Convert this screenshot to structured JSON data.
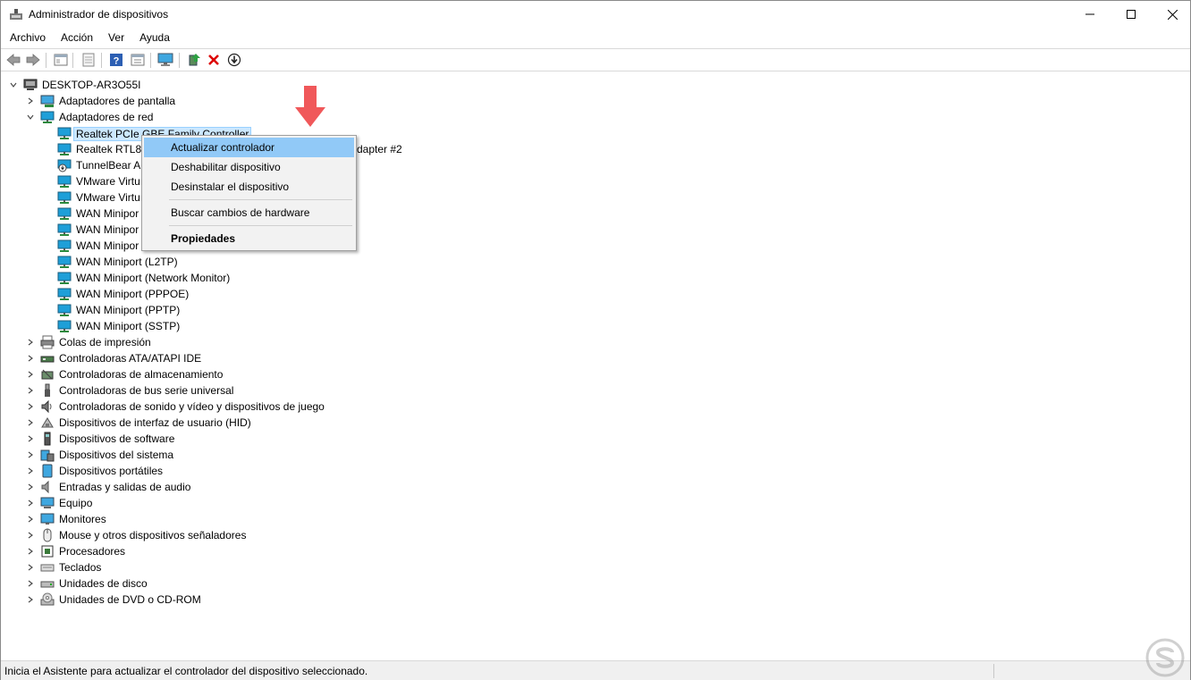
{
  "window": {
    "title": "Administrador de dispositivos",
    "controls": {
      "minimize": "—",
      "maximize": "☐",
      "close": "✕"
    }
  },
  "menu": [
    "Archivo",
    "Acción",
    "Ver",
    "Ayuda"
  ],
  "toolbar": {
    "icons": [
      "back-icon",
      "forward-icon",
      "properties-view-icon",
      "properties-icon",
      "help-icon",
      "resources-icon",
      "monitor-icon",
      "update-driver-icon",
      "uninstall-icon",
      "scan-hardware-icon"
    ]
  },
  "tree": {
    "root": "DESKTOP-AR3O55I",
    "items": [
      {
        "label": "Adaptadores de pantalla",
        "icon": "display-adapter-icon",
        "level": 1,
        "expander": "collapsed"
      },
      {
        "label": "Adaptadores de red",
        "icon": "network-icon",
        "level": 1,
        "expander": "expanded"
      },
      {
        "label": "Realtek PCIe GBE Family Controller",
        "icon": "network-icon",
        "level": 2,
        "selected": true
      },
      {
        "label": "Realtek RTL81",
        "suffix": "dapter #2",
        "icon": "network-icon",
        "level": 2
      },
      {
        "label": "TunnelBear A",
        "icon": "network-warning-icon",
        "level": 2
      },
      {
        "label": "VMware Virtu",
        "icon": "network-icon",
        "level": 2
      },
      {
        "label": "VMware Virtu",
        "icon": "network-icon",
        "level": 2
      },
      {
        "label": "WAN Minipor",
        "icon": "network-icon",
        "level": 2
      },
      {
        "label": "WAN Minipor",
        "icon": "network-icon",
        "level": 2
      },
      {
        "label": "WAN Minipor",
        "icon": "network-icon",
        "level": 2
      },
      {
        "label": "WAN Miniport (L2TP)",
        "icon": "network-icon",
        "level": 2
      },
      {
        "label": "WAN Miniport (Network Monitor)",
        "icon": "network-icon",
        "level": 2
      },
      {
        "label": "WAN Miniport (PPPOE)",
        "icon": "network-icon",
        "level": 2
      },
      {
        "label": "WAN Miniport (PPTP)",
        "icon": "network-icon",
        "level": 2
      },
      {
        "label": "WAN Miniport (SSTP)",
        "icon": "network-icon",
        "level": 2
      },
      {
        "label": "Colas de impresión",
        "icon": "printer-icon",
        "level": 1,
        "expander": "collapsed"
      },
      {
        "label": "Controladoras ATA/ATAPI IDE",
        "icon": "ide-controller-icon",
        "level": 1,
        "expander": "collapsed"
      },
      {
        "label": "Controladoras de almacenamiento",
        "icon": "storage-controller-icon",
        "level": 1,
        "expander": "collapsed"
      },
      {
        "label": "Controladoras de bus serie universal",
        "icon": "usb-icon",
        "level": 1,
        "expander": "collapsed"
      },
      {
        "label": "Controladoras de sonido y vídeo y dispositivos de juego",
        "icon": "sound-icon",
        "level": 1,
        "expander": "collapsed"
      },
      {
        "label": "Dispositivos de interfaz de usuario (HID)",
        "icon": "hid-icon",
        "level": 1,
        "expander": "collapsed"
      },
      {
        "label": "Dispositivos de software",
        "icon": "software-device-icon",
        "level": 1,
        "expander": "collapsed"
      },
      {
        "label": "Dispositivos del sistema",
        "icon": "system-device-icon",
        "level": 1,
        "expander": "collapsed"
      },
      {
        "label": "Dispositivos portátiles",
        "icon": "portable-device-icon",
        "level": 1,
        "expander": "collapsed"
      },
      {
        "label": "Entradas y salidas de audio",
        "icon": "audio-io-icon",
        "level": 1,
        "expander": "collapsed"
      },
      {
        "label": "Equipo",
        "icon": "computer-icon",
        "level": 1,
        "expander": "collapsed"
      },
      {
        "label": "Monitores",
        "icon": "monitor-icon",
        "level": 1,
        "expander": "collapsed"
      },
      {
        "label": "Mouse y otros dispositivos señaladores",
        "icon": "mouse-icon",
        "level": 1,
        "expander": "collapsed"
      },
      {
        "label": "Procesadores",
        "icon": "processor-icon",
        "level": 1,
        "expander": "collapsed"
      },
      {
        "label": "Teclados",
        "icon": "keyboard-icon",
        "level": 1,
        "expander": "collapsed"
      },
      {
        "label": "Unidades de disco",
        "icon": "disk-drive-icon",
        "level": 1,
        "expander": "collapsed"
      },
      {
        "label": "Unidades de DVD o CD-ROM",
        "icon": "dvd-icon",
        "level": 1,
        "expander": "collapsed"
      }
    ]
  },
  "context_menu": {
    "items": [
      {
        "label": "Actualizar controlador",
        "highlighted": true
      },
      {
        "label": "Deshabilitar dispositivo"
      },
      {
        "label": "Desinstalar el dispositivo"
      },
      {
        "label": "Buscar cambios de hardware"
      },
      {
        "label": "Propiedades",
        "bold": true
      }
    ]
  },
  "status": {
    "text": "Inicia el Asistente para actualizar el controlador del dispositivo seleccionado."
  },
  "colors": {
    "accent_annotation": "#f0585a",
    "selection": "#cce8ff",
    "menu_highlight": "#91c9f7",
    "network_icon": "#1e9fd8"
  }
}
